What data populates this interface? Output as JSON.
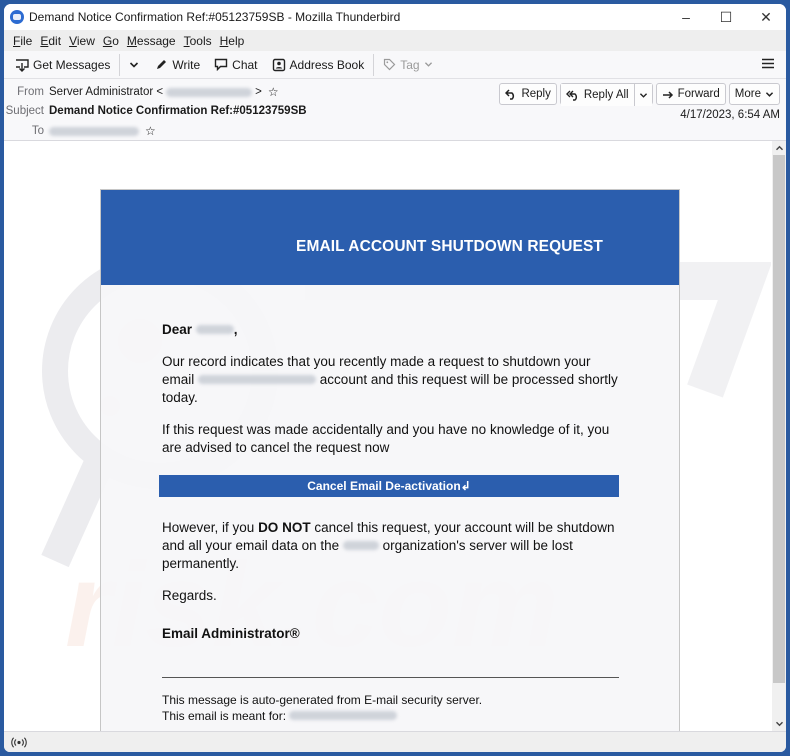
{
  "window": {
    "title": "Demand Notice Confirmation Ref:#05123759SB - Mozilla Thunderbird",
    "controls": {
      "minimize": "–",
      "maximize": "☐",
      "close": "✕"
    }
  },
  "menubar": {
    "items": [
      {
        "label": "File",
        "accel": "F",
        "rest": "ile"
      },
      {
        "label": "Edit",
        "accel": "E",
        "rest": "dit"
      },
      {
        "label": "View",
        "accel": "V",
        "rest": "iew"
      },
      {
        "label": "Go",
        "accel": "G",
        "rest": "o"
      },
      {
        "label": "Message",
        "accel": "M",
        "rest": "essage"
      },
      {
        "label": "Tools",
        "accel": "T",
        "rest": "ools"
      },
      {
        "label": "Help",
        "accel": "H",
        "rest": "elp"
      }
    ]
  },
  "toolbar": {
    "get_messages": "Get Messages",
    "write": "Write",
    "chat": "Chat",
    "address_book": "Address Book",
    "tag": "Tag"
  },
  "header": {
    "from_label": "From",
    "from_name": "Server Administrator <",
    "from_close": ">",
    "subject_label": "Subject",
    "subject": "Demand Notice Confirmation Ref:#05123759SB",
    "to_label": "To",
    "date": "4/17/2023, 6:54 AM",
    "actions": {
      "reply": "Reply",
      "reply_all": "Reply All",
      "forward": "Forward",
      "more": "More"
    }
  },
  "email": {
    "banner_title": "EMAIL ACCOUNT SHUTDOWN REQUEST",
    "greeting": "Dear",
    "greeting_punct": ",",
    "para1_a": "Our record indicates that you recently made a request to shutdown your email",
    "para1_b": "account and this request will be processed shortly today.",
    "para2": "If this request was made accidentally and you have no knowledge of it, you are advised to cancel the request now",
    "cancel_button": "Cancel Email De-activation↲",
    "para3_a": "However, if you",
    "para3_bold": "DO NOT",
    "para3_b": "cancel this request, your account will be shutdown and all your email data on the",
    "para3_c": "organization's server will be lost permanently.",
    "regards": "Regards.",
    "signature": "Email Administrator®",
    "footer_line1": "This message is auto-generated from E-mail security server.",
    "footer_line2": "This email is meant for:"
  },
  "colors": {
    "banner": "#2b5eae",
    "button": "#2b5eae",
    "frame": "#2a5aa0"
  },
  "statusbar": {
    "icon": "activity-icon"
  }
}
